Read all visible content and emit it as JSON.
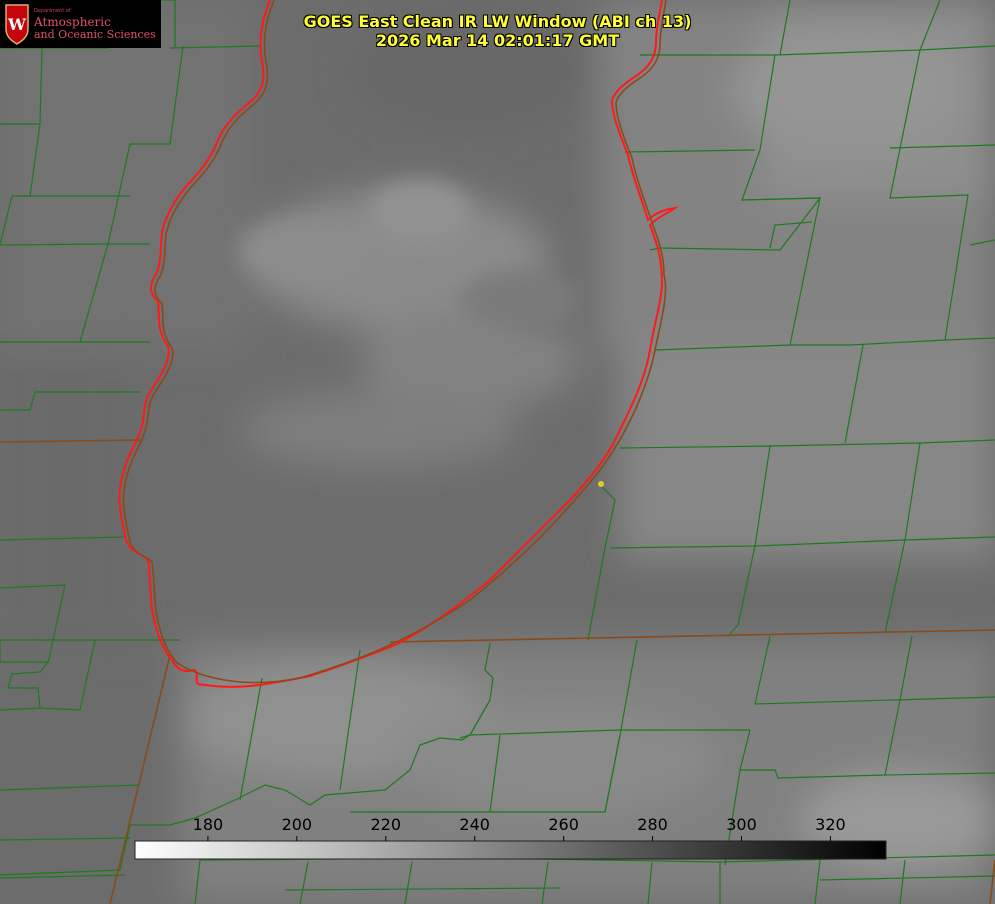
{
  "title": {
    "line1": "GOES East Clean IR LW Window (ABI ch 13)",
    "line2": "2026 Mar 14 02:01:17 GMT"
  },
  "logo": {
    "department": "Department of",
    "line1": "Atmospheric",
    "line2": "and Oceanic Sciences",
    "crest_icon": "uw-crest-icon",
    "crest_letter": "W"
  },
  "colorbar": {
    "ticks": [
      "180",
      "200",
      "220",
      "240",
      "260",
      "280",
      "300",
      "320"
    ],
    "tick_values": [
      180,
      200,
      220,
      240,
      260,
      280,
      300,
      320
    ],
    "min": 163.6,
    "max": 332.5,
    "gradient": [
      "#ffffff",
      "#000000"
    ]
  },
  "colors": {
    "county_lines": "#1f7a1f",
    "state_lines": "#8a4a1a",
    "shoreline": "#ff1a1a",
    "title_text": "#ffff33",
    "station_marker": "#e0d020"
  }
}
